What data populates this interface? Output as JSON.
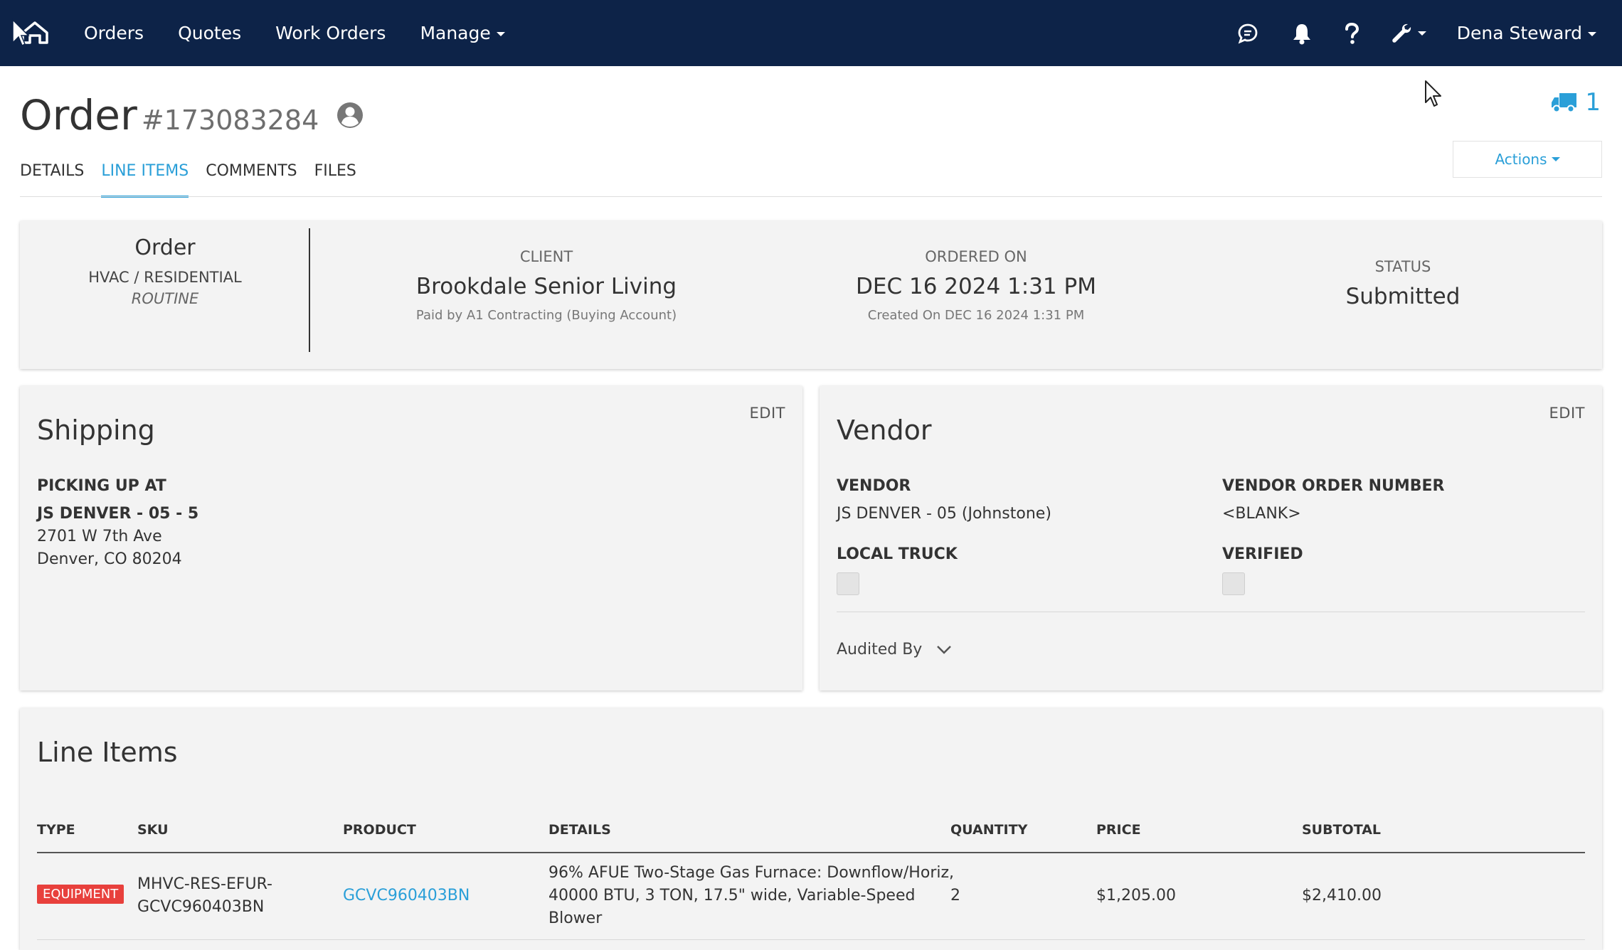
{
  "nav": {
    "links": [
      "Orders",
      "Quotes",
      "Work Orders",
      "Manage"
    ],
    "user": "Dena Steward",
    "icons": [
      "home-icon",
      "chat-icon",
      "bell-icon",
      "help-icon",
      "wrench-icon"
    ]
  },
  "header": {
    "title": "Order",
    "order_number": "#173083284",
    "truck_count": "1",
    "actions_label": "Actions"
  },
  "tabs": [
    "DETAILS",
    "LINE ITEMS",
    "COMMENTS",
    "FILES"
  ],
  "active_tab": "LINE ITEMS",
  "summary": {
    "type_title": "Order",
    "category": "HVAC / RESIDENTIAL",
    "priority": "ROUTINE",
    "client_label": "CLIENT",
    "client": "Brookdale Senior Living",
    "client_sub": "Paid by A1 Contracting (Buying Account)",
    "ordered_label": "ORDERED ON",
    "ordered_on": "DEC 16 2024 1:31 PM",
    "created_on": "Created On DEC 16 2024 1:31 PM",
    "status_label": "STATUS",
    "status": "Submitted"
  },
  "shipping": {
    "title": "Shipping",
    "edit": "EDIT",
    "pickup_label": "PICKING UP AT",
    "location_name": "JS DENVER - 05 - 5",
    "address1": "2701 W 7th Ave",
    "address2": "Denver, CO 80204"
  },
  "vendor": {
    "title": "Vendor",
    "edit": "EDIT",
    "vendor_label": "VENDOR",
    "vendor_value": "JS DENVER - 05 (Johnstone)",
    "order_number_label": "VENDOR ORDER NUMBER",
    "order_number_value": "<BLANK>",
    "local_truck_label": "LOCAL TRUCK",
    "verified_label": "VERIFIED",
    "audited_by": "Audited By"
  },
  "line_items": {
    "title": "Line Items",
    "columns": [
      "TYPE",
      "SKU",
      "PRODUCT",
      "DETAILS",
      "QUANTITY",
      "PRICE",
      "SUBTOTAL"
    ],
    "rows": [
      {
        "type": "EQUIPMENT",
        "sku_line1": "MHVC-RES-EFUR-",
        "sku_line2": "GCVC960403BN",
        "product": "GCVC960403BN",
        "details_line1": "96% AFUE Two-Stage Gas Furnace: Downflow/Horiz,",
        "details_line2": "40000 BTU, 3 TON, 17.5\" wide, Variable-Speed",
        "details_line3": "Blower",
        "quantity": "2",
        "price": "$1,205.00",
        "subtotal": "$2,410.00"
      }
    ]
  }
}
